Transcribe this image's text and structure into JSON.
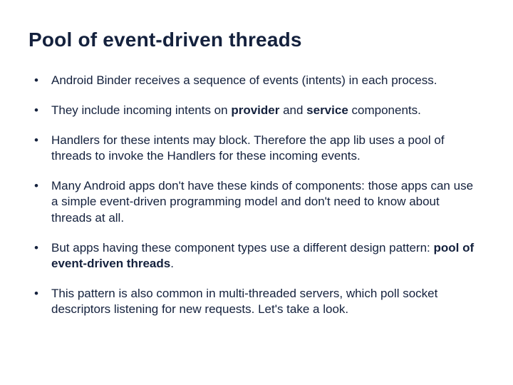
{
  "title": "Pool of event-driven threads",
  "bullets": [
    {
      "pre": "Android Binder receives a sequence of events (intents) in each process.",
      "bold1": "",
      "mid": "",
      "bold2": "",
      "post": ""
    },
    {
      "pre": "They include incoming intents on ",
      "bold1": "provider",
      "mid": " and ",
      "bold2": "service",
      "post": " components."
    },
    {
      "pre": "Handlers for these intents may block.  Therefore the app lib uses a pool of threads to invoke the Handlers for these incoming events.",
      "bold1": "",
      "mid": "",
      "bold2": "",
      "post": ""
    },
    {
      "pre": "Many Android apps don't have these kinds of components: those apps can use a simple event-driven programming model and don't need to know about threads at all.",
      "bold1": "",
      "mid": "",
      "bold2": "",
      "post": ""
    },
    {
      "pre": "But apps having these component types use a different design pattern: ",
      "bold1": "pool of event-driven threads",
      "mid": ".",
      "bold2": "",
      "post": ""
    },
    {
      "pre": "This pattern is also common in multi-threaded servers, which poll socket descriptors listening for new requests.   Let's take a look.",
      "bold1": "",
      "mid": "",
      "bold2": "",
      "post": ""
    }
  ]
}
